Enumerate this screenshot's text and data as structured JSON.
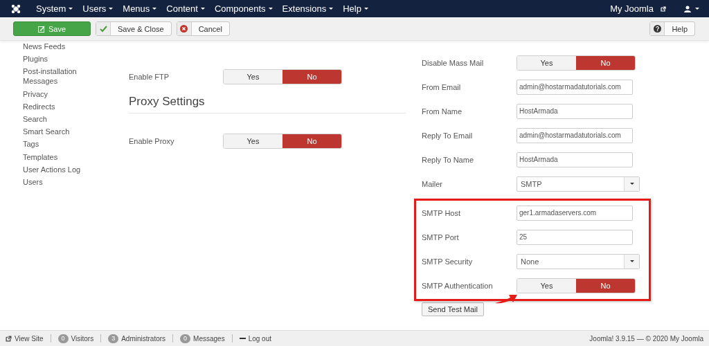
{
  "navbar": {
    "menus": [
      {
        "label": "System"
      },
      {
        "label": "Users"
      },
      {
        "label": "Menus"
      },
      {
        "label": "Content"
      },
      {
        "label": "Components"
      },
      {
        "label": "Extensions"
      },
      {
        "label": "Help"
      }
    ],
    "site_link": "My Joomla"
  },
  "toolbar": {
    "buttons": [
      {
        "label": "Save",
        "kind": "primary"
      },
      {
        "label": "Save & Close",
        "kind": "check"
      },
      {
        "label": "Cancel",
        "kind": "cancel"
      }
    ],
    "help": "Help"
  },
  "sidebar": {
    "items": [
      {
        "label": "News Feeds"
      },
      {
        "label": "Plugins"
      },
      {
        "label": "Post-installation Messages"
      },
      {
        "label": "Privacy"
      },
      {
        "label": "Redirects"
      },
      {
        "label": "Search"
      },
      {
        "label": "Smart Search"
      },
      {
        "label": "Tags"
      },
      {
        "label": "Templates"
      },
      {
        "label": "User Actions Log"
      },
      {
        "label": "Users"
      }
    ]
  },
  "ftp": {
    "fields": [
      {
        "label": "Enable FTP",
        "options": [
          {
            "label": "Yes",
            "selected": false
          },
          {
            "label": "No",
            "selected": true
          }
        ]
      }
    ]
  },
  "proxy": {
    "heading": "Proxy Settings",
    "fields": [
      {
        "label": "Enable Proxy",
        "options": [
          {
            "label": "Yes",
            "selected": false
          },
          {
            "label": "No",
            "selected": true
          }
        ]
      }
    ]
  },
  "mail": {
    "fields": [
      {
        "kind": "toggle",
        "label": "Disable Mass Mail",
        "options": [
          {
            "label": "Yes",
            "selected": false
          },
          {
            "label": "No",
            "selected": true
          }
        ]
      },
      {
        "kind": "text",
        "label": "From Email",
        "value": "admin@hostarmadatutorials.com"
      },
      {
        "kind": "text",
        "label": "From Name",
        "value": "HostArmada"
      },
      {
        "kind": "text",
        "label": "Reply To Email",
        "value": "admin@hostarmadatutorials.com"
      },
      {
        "kind": "text",
        "label": "Reply To Name",
        "value": "HostArmada"
      },
      {
        "kind": "select",
        "label": "Mailer",
        "value": "SMTP"
      }
    ],
    "highlighted_fields": [
      {
        "kind": "text",
        "label": "SMTP Host",
        "value": "ger1.armadaservers.com"
      },
      {
        "kind": "text",
        "label": "SMTP Port",
        "value": "25"
      },
      {
        "kind": "select",
        "label": "SMTP Security",
        "value": "None"
      },
      {
        "kind": "toggle",
        "label": "SMTP Authentication",
        "options": [
          {
            "label": "Yes",
            "selected": false
          },
          {
            "label": "No",
            "selected": true
          }
        ]
      }
    ],
    "send_button": "Send Test Mail"
  },
  "status_bar": {
    "items": [
      {
        "kind": "link",
        "label": "View Site"
      },
      {
        "kind": "count",
        "count": "0",
        "label": "Visitors"
      },
      {
        "kind": "count",
        "count": "3",
        "label": "Administrators"
      },
      {
        "kind": "count",
        "count": "0",
        "label": "Messages"
      },
      {
        "kind": "logout",
        "label": "Log out"
      }
    ],
    "version": "Joomla! 3.9.15 — © 2020 My Joomla"
  }
}
